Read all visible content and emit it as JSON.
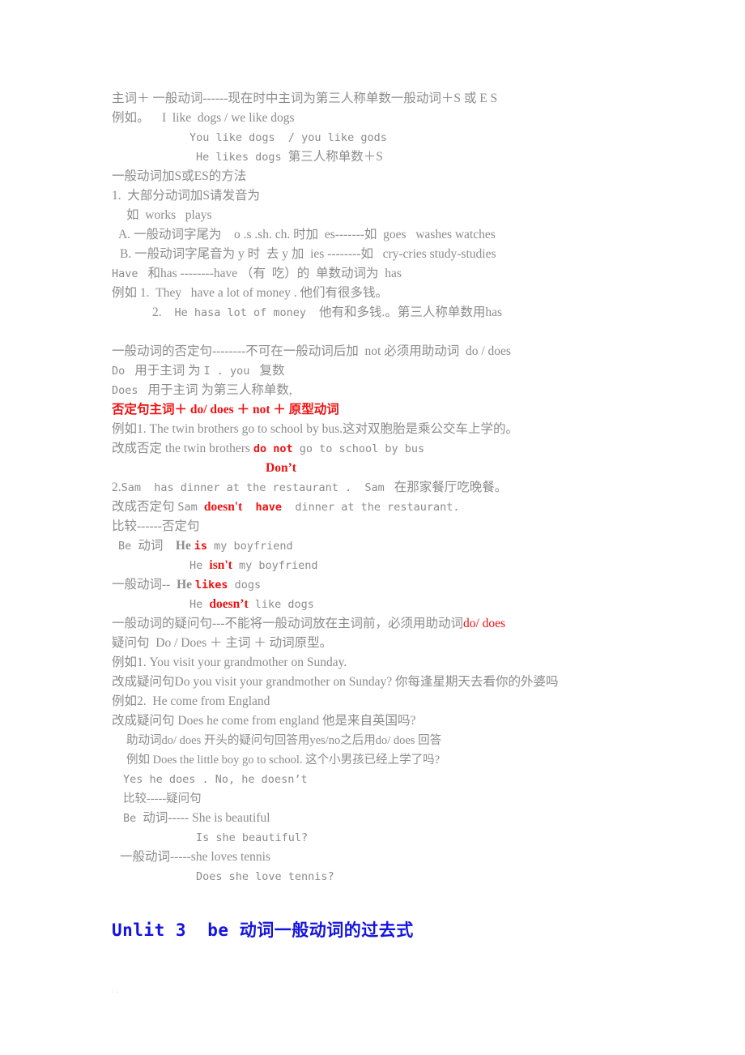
{
  "document": {
    "title_heading": "Unlit 3  be 动词一般动词的过去式",
    "heading_color": "#1414e0",
    "body_color": "#8c8c8c",
    "accent_color": "#ee1111",
    "lines": [
      {
        "id": "l01",
        "indent": 0,
        "text": "主词＋ 一般动词------现在时中主词为第三人称单数一般动词＋S 或 E S"
      },
      {
        "id": "l02",
        "indent": 0,
        "text": "例如。    I  like  dogs / we like dogs"
      },
      {
        "id": "l03",
        "indent": 96,
        "text": "You like dogs  / you like gods"
      },
      {
        "id": "l04",
        "indent": 104,
        "text": "He likes dogs 第三人称单数＋S"
      },
      {
        "id": "l05",
        "indent": 0,
        "text": "一般动词加S或ES的方法"
      },
      {
        "id": "l06",
        "indent": 0,
        "text": "1.  大部分动词加S请发音为"
      },
      {
        "id": "l07",
        "indent": 18,
        "text": "如  works   plays"
      },
      {
        "id": "l08",
        "indent": 8,
        "text": "A. 一般动词字尾为    o .s .sh. ch. 时加  es-------如  goes   washes watches"
      },
      {
        "id": "l09",
        "indent": 10,
        "text": "B. 一般动词字尾音为 y 时  去 y 加  ies --------如   cry-cries study-studies"
      },
      {
        "id": "l10",
        "indent": 0,
        "text": "Have  和has --------have （有  吃）的  单数动词为  has"
      },
      {
        "id": "l11",
        "indent": 0,
        "text": "例如 1.  They   have a lot of money . 他们有很多钱。"
      },
      {
        "id": "l12",
        "indent": 50,
        "text": "2.   He hasa lot of money   他有和多钱.。第三人称单数用has"
      },
      {
        "id": "l13",
        "indent": 0,
        "text": ""
      },
      {
        "id": "l14",
        "indent": 0,
        "text": "一般动词的否定句--------不可在一般动词后加  not 必须用助动词  do / does"
      },
      {
        "id": "l15",
        "indent": 0,
        "text": "Do 用于主词 为 I . you 复数"
      },
      {
        "id": "l16",
        "indent": 0,
        "text": "Does 用于主词 为第三人称单数,"
      },
      {
        "id": "l17",
        "indent": 0,
        "text": "否定句主词＋ do/ does ＋ not ＋ 原型动词",
        "color": "red"
      },
      {
        "id": "l18",
        "indent": 0,
        "text": "例如1. The twin brothers go to school by bus.这对双胞胎是乘公交车上学的。"
      },
      {
        "id": "l19",
        "indent": 0,
        "text": "改成否定 the twin brothers do not go to school by bus"
      },
      {
        "id": "l20",
        "indent": 190,
        "text": "Don’t",
        "color": "red"
      },
      {
        "id": "l21",
        "indent": 0,
        "text": "2.Sam  has dinner at the restaurant .  Sam 在那家餐厅吃晚餐。"
      },
      {
        "id": "l22",
        "indent": 0,
        "text": "改成否定句 Sam doesn't  have  dinner at the restaurant."
      },
      {
        "id": "l23",
        "indent": 0,
        "text": "比较------否定句"
      },
      {
        "id": "l24",
        "indent": 8,
        "text": "Be 动词    He is my boyfriend"
      },
      {
        "id": "l25",
        "indent": 96,
        "text": "He isn't my boyfriend"
      },
      {
        "id": "l26",
        "indent": 0,
        "text": "一般动词--  He likes dogs"
      },
      {
        "id": "l27",
        "indent": 96,
        "text": "He doesn’t like dogs"
      },
      {
        "id": "l28",
        "indent": 0,
        "text": "一般动词的疑问句---不能将一般动词放在主词前，必须用助动词do/ does"
      },
      {
        "id": "l29",
        "indent": 0,
        "text": "疑问句  Do / Does ＋ 主词 ＋ 动词原型。"
      },
      {
        "id": "l30",
        "indent": 0,
        "text": "例如1. You visit your grandmother on Sunday."
      },
      {
        "id": "l31",
        "indent": 0,
        "text": "改成疑问句Do you visit your grandmother on Sunday? 你每逢星期天去看你的外婆吗"
      },
      {
        "id": "l32",
        "indent": 0,
        "text": "例如2.  He come from England"
      },
      {
        "id": "l33",
        "indent": 0,
        "text": "改成疑问句 Does he come from england 他是来自英国吗?"
      },
      {
        "id": "l34",
        "indent": 18,
        "text": "助动词do/ does 开头的疑问句回答用yes/no之后用do/ does 回答"
      },
      {
        "id": "l35",
        "indent": 18,
        "text": "例如 Does the little boy go to school. 这个小男孩已经上学了吗?"
      },
      {
        "id": "l36",
        "indent": 14,
        "text": "Yes he does . No, he doesn’t"
      },
      {
        "id": "l37",
        "indent": 14,
        "text": "比较-----疑问句"
      },
      {
        "id": "l38",
        "indent": 14,
        "text": "Be 动词----- She is beautiful"
      },
      {
        "id": "l39",
        "indent": 104,
        "text": "Is she beautiful?"
      },
      {
        "id": "l40",
        "indent": 10,
        "text": "一般动词-----she loves tennis"
      },
      {
        "id": "l41",
        "indent": 104,
        "text": "Does she love tennis?"
      }
    ]
  }
}
